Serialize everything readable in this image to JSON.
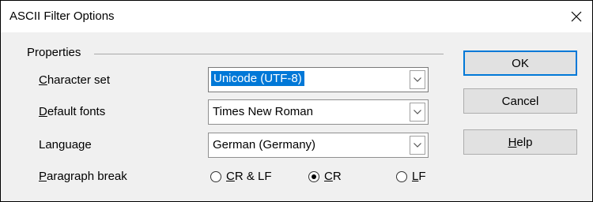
{
  "window": {
    "title": "ASCII Filter Options",
    "close_glyph": "✕"
  },
  "properties": {
    "group_label": "Properties",
    "character_set": {
      "label_mnemonic": "C",
      "label_rest": "haracter set",
      "value": "Unicode (UTF-8)"
    },
    "default_fonts": {
      "label_mnemonic": "D",
      "label_rest": "efault fonts",
      "value": "Times New Roman"
    },
    "language": {
      "label": "Language",
      "value": "German (Germany)"
    },
    "paragraph_break": {
      "label_mnemonic": "P",
      "label_rest": "aragraph break",
      "options": [
        {
          "mnemonic": "C",
          "rest": "R & LF",
          "selected": false
        },
        {
          "mnemonic": "C",
          "rest": "R",
          "selected": true
        },
        {
          "mnemonic": "L",
          "rest": "F",
          "selected": false
        }
      ]
    }
  },
  "buttons": {
    "ok": "OK",
    "cancel": "Cancel",
    "help_mnemonic": "H",
    "help_rest": "elp"
  },
  "icons": {
    "dropdown": "chevron-down-icon",
    "close": "close-icon"
  },
  "colors": {
    "accent": "#0078d7"
  }
}
